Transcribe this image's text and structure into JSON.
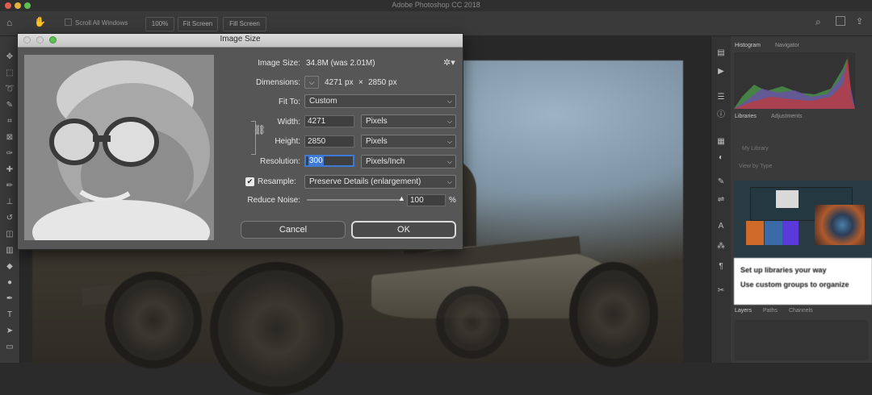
{
  "app": {
    "title": "Adobe Photoshop CC 2018",
    "options_bar": {
      "scroll_all_windows": "Scroll All Windows",
      "zoom_100": "100%",
      "fit_screen": "Fit Screen",
      "fill_screen": "Fill Screen"
    }
  },
  "panels": {
    "tabs_top": [
      "Histogram",
      "Navigator"
    ],
    "tabs_mid": [
      "Libraries",
      "Adjustments"
    ],
    "library_name": "My Library",
    "view_by": "View by Type",
    "promo_title": "Set up libraries your way",
    "promo_body": "Use custom groups to organize",
    "tabs_bottom": [
      "Layers",
      "Paths",
      "Channels"
    ]
  },
  "dialog": {
    "title": "Image Size",
    "image_size_label": "Image Size:",
    "image_size_value": "34.8M (was 2.01M)",
    "dimensions_label": "Dimensions:",
    "dim_width": "4271 px",
    "dim_times": "×",
    "dim_height": "2850 px",
    "fit_to_label": "Fit To:",
    "fit_to_value": "Custom",
    "width_label": "Width:",
    "width_value": "4271",
    "width_unit": "Pixels",
    "height_label": "Height:",
    "height_value": "2850",
    "height_unit": "Pixels",
    "resolution_label": "Resolution:",
    "resolution_value": "300",
    "resolution_unit": "Pixels/Inch",
    "resample_label": "Resample:",
    "resample_checked": true,
    "resample_value": "Preserve Details (enlargement)",
    "reduce_noise_label": "Reduce Noise:",
    "reduce_noise_value": "100",
    "reduce_noise_unit": "%",
    "reduce_noise_level": 1.0,
    "cancel_label": "Cancel",
    "ok_label": "OK"
  },
  "colors": {
    "dialog_bg": "#565656",
    "accent_focus": "#3d7bd6",
    "ok_border": "#d9d9d9"
  }
}
